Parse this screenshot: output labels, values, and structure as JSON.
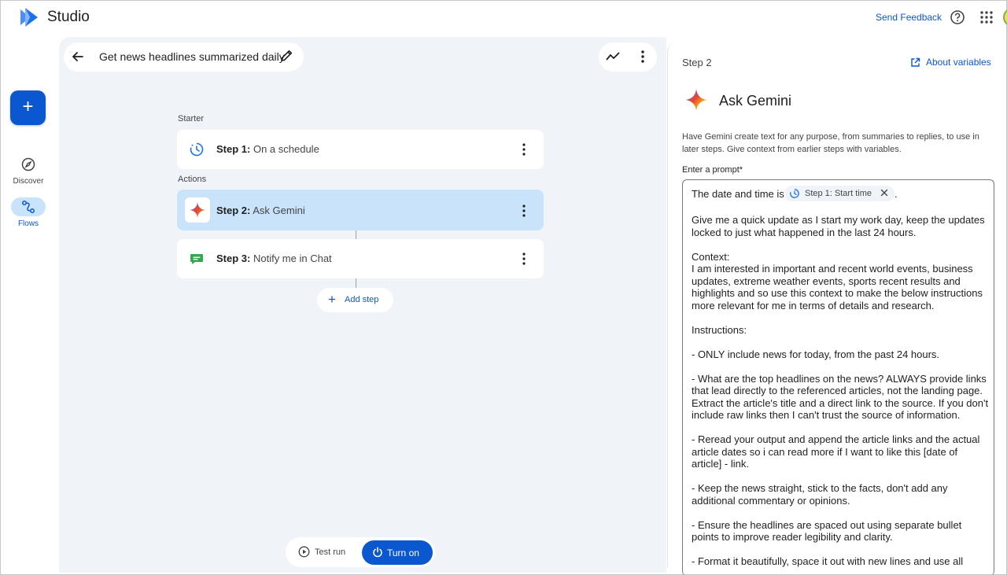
{
  "app": {
    "title": "Studio",
    "send_feedback": "Send Feedback"
  },
  "rail": {
    "new_label": "+",
    "items": [
      {
        "label": "Discover",
        "icon": "compass-icon"
      },
      {
        "label": "Flows",
        "icon": "flows-icon"
      }
    ]
  },
  "flow": {
    "title": "Get news headlines summarized daily",
    "starter_label": "Starter",
    "actions_label": "Actions",
    "steps": [
      {
        "num": "Step 1:",
        "name": "On a schedule",
        "icon": "schedule-icon"
      },
      {
        "num": "Step 2:",
        "name": "Ask Gemini",
        "icon": "gemini-icon"
      },
      {
        "num": "Step 3:",
        "name": "Notify me in Chat",
        "icon": "chat-icon"
      }
    ],
    "add_step": "Add step",
    "test_run": "Test run",
    "turn_on": "Turn on"
  },
  "panel": {
    "step_label": "Step 2",
    "about_variables": "About variables",
    "title": "Ask Gemini",
    "description": "Have Gemini create text for any purpose, from summaries to replies, to use in later steps. Give context from earlier steps with variables.",
    "prompt_label": "Enter a prompt*",
    "prompt_intro": "The date and time is",
    "chip_label": "Step 1: Start time",
    "chip_suffix": ".",
    "prompt_body": "Give me a quick update as I start my work day, keep the updates locked to just what happened in the last 24 hours.\n\nContext:\nI am interested in important and recent world events, business updates, extreme weather events, sports recent results and highlights and so use this context to make the below instructions more relevant for me in terms of details and research.\n\nInstructions:\n\n- ONLY include news for today, from the past 24 hours.\n\n- What are the top headlines on the news? ALWAYS provide links that lead directly to the referenced articles, not the landing page. Extract the article's title and a direct link to the source. If you don't include raw links then I can't trust the source of information.\n\n- Reread your output and append the article links and the actual article dates so i can read more if I want to like this [date of article] - link.\n\n- Keep the news straight, stick to the facts, don't add any additional commentary or opinions.\n\n- Ensure the headlines are spaced out using separate bullet points to improve reader legibility and clarity.\n\n- Format it beautifully, space it out with new lines and use all"
  },
  "colors": {
    "accent": "#0b57d0",
    "selected": "#c9e3fb",
    "canvas": "#f0f4f9"
  }
}
